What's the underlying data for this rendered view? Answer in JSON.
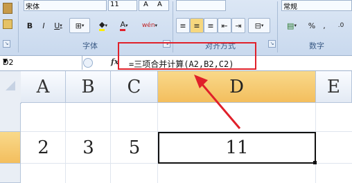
{
  "ribbon": {
    "font_group_label": "字体",
    "align_group_label": "对齐方式",
    "number_group_label": "数字",
    "font_name": "宋体",
    "font_size": "11",
    "bold": "B",
    "italic": "I",
    "underline": "U",
    "font_color": "A",
    "phonetic": "wén",
    "percent": "%",
    "comma": ",",
    "increase_decimal": ".0",
    "number_format": "常规"
  },
  "formula_bar": {
    "name_box": "D2",
    "fx": "fx",
    "formula": "=三项合并计算(A2,B2,C2)"
  },
  "grid": {
    "columns": [
      "A",
      "B",
      "C",
      "D",
      "E"
    ],
    "active_column": "D",
    "active_row": "2",
    "row2": {
      "A": "2",
      "B": "3",
      "C": "5",
      "D": "11"
    }
  },
  "annotation": {
    "color": "#e0202a"
  }
}
